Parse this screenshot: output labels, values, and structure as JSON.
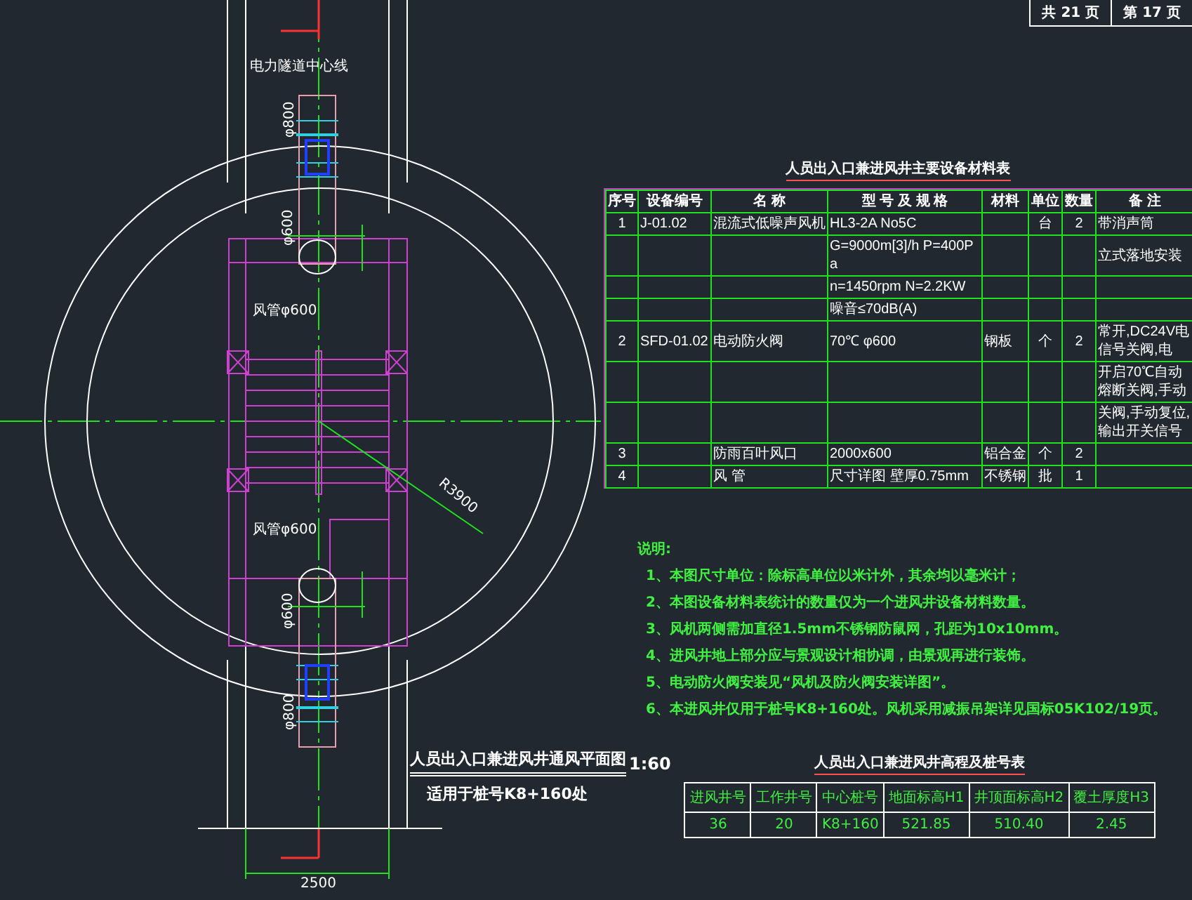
{
  "page_counter": [
    "共 21 页",
    "第 17 页"
  ],
  "equipment_table": {
    "title": "人员出入口兼进风井主要设备材料表",
    "columns": [
      "序号",
      "设备编号",
      "名 称",
      "型 号 及 规 格",
      "材料",
      "单位",
      "数量",
      "备 注"
    ],
    "rows": [
      [
        "1",
        "J-01.02",
        "混流式低噪声风机",
        "HL3-2A No5C",
        null,
        "台",
        "2",
        "带消声筒"
      ],
      [
        null,
        null,
        null,
        "G=9000m[3]/h P=400Pa",
        null,
        null,
        null,
        "立式落地安装"
      ],
      [
        null,
        null,
        null,
        "n=1450rpm N=2.2KW",
        null,
        null,
        null,
        null
      ],
      [
        null,
        null,
        null,
        "噪音≤70dB(A)",
        null,
        null,
        null,
        null
      ],
      [
        "2",
        "SFD-01.02",
        "电动防火阀",
        "70℃    φ600",
        "钢板",
        "个",
        "2",
        "常开,DC24V电信号关阀,电"
      ],
      [
        null,
        null,
        null,
        null,
        null,
        null,
        null,
        "开启70℃自动熔断关阀,手动"
      ],
      [
        null,
        null,
        null,
        null,
        null,
        null,
        null,
        "关阀,手动复位,输出开关信号"
      ],
      [
        "3",
        null,
        "防雨百叶风口",
        "2000x600",
        "铝合金",
        "个",
        "2",
        null
      ],
      [
        "4",
        null,
        "风 管",
        "尺寸详图  壁厚0.75mm",
        "不锈钢",
        "批",
        "1",
        null
      ]
    ]
  },
  "notes": {
    "title": "说明:",
    "items": [
      "1、本图尺寸单位：除标高单位以米计外，其余均以毫米计；",
      "2、本图设备材料表统计的数量仅为一个进风井设备材料数量。",
      "3、风机两侧需加直径1.5mm不锈钢防鼠网，孔距为10x10mm。",
      "4、进风井地上部分应与景观设计相协调，由景观再进行装饰。",
      "5、电动防火阀安装见“风机及防火阀安装详图”。",
      "6、本进风井仅用于桩号K8+160处。风机采用减振吊架详见国标05K102/19页。"
    ]
  },
  "plan": {
    "title": "人员出入口兼进风井通风平面图",
    "scale": "1:60",
    "subtitle": "适用于桩号K8+160处"
  },
  "drawing_labels": [
    "电力隧道中心线",
    "φ800",
    "φ600",
    "风管φ600",
    "R3900",
    "风管φ600",
    "φ600",
    "φ800",
    "2500"
  ],
  "elevation_table": {
    "title": "人员出入口兼进风井高程及桩号表",
    "columns": [
      "进风井号",
      "工作井号",
      "中心桩号",
      "地面标高H1",
      "井顶面标高H2",
      "覆土厚度H3"
    ],
    "rows": [
      [
        "36",
        "20",
        "K8+160",
        "521.85",
        "510.40",
        "2.45"
      ]
    ]
  }
}
